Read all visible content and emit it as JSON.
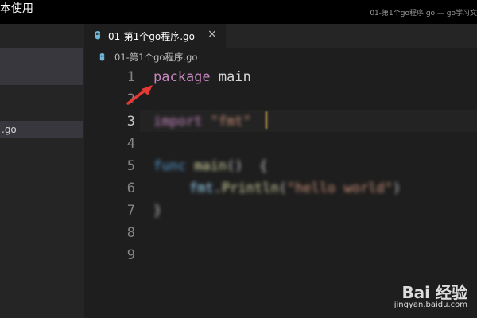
{
  "window": {
    "left_title": "本使用",
    "right_title": "01-第1个go程序.go — go学习文"
  },
  "sidebar": {
    "file_label": ".go"
  },
  "tab": {
    "name": "01-第1个go程序.go",
    "close": "×",
    "icon": "go-file-icon"
  },
  "breadcrumb": {
    "name": "01-第1个go程序.go"
  },
  "editor": {
    "line_numbers": [
      "1",
      "2",
      "3",
      "4",
      "5",
      "6",
      "7",
      "8",
      "9"
    ],
    "active_line": "3",
    "lines": {
      "l1_kw": "package",
      "l1_rest": " main",
      "l3_kw": "import",
      "l3_str": " \"fmt\"",
      "l5_kw": "func",
      "l5_fn": " main",
      "l5_rest": "()  {",
      "l6_pkg": "fmt",
      "l6_dot": ".",
      "l6_fn": "Println",
      "l6_open": "(",
      "l6_str": "\"hello world\"",
      "l6_close": ")",
      "l7": "}"
    }
  },
  "colors": {
    "keyword": "#c586c0",
    "annotation_arrow": "#e53935"
  },
  "watermark": {
    "brand": "Bai 经验",
    "url": "jingyan.baidu.com"
  }
}
